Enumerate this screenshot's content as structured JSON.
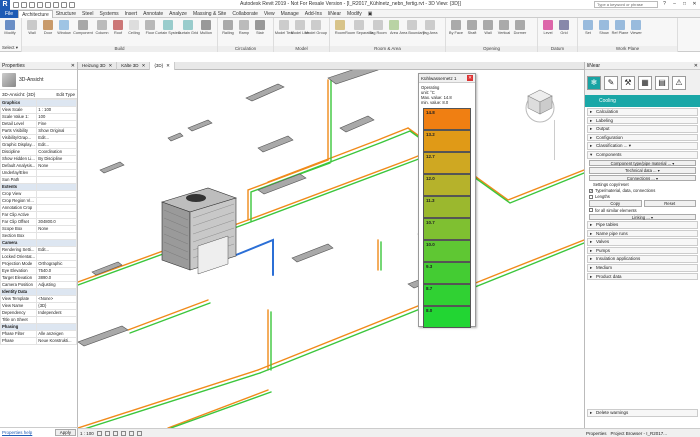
{
  "window": {
    "title": "Autodesk Revit 2019 - Not For Resale Version - [I_R2017_Kühlnetz_nebn_fertig.rvt - 3D View: {3D}]",
    "search_placeholder": "Type a keyword or phrase",
    "controls": [
      "?",
      "–",
      "□",
      "✕"
    ]
  },
  "ribbon": {
    "tabs": [
      "File",
      "Architecture",
      "Structure",
      "Steel",
      "Systems",
      "Insert",
      "Annotate",
      "Analyze",
      "Massing & Site",
      "Collaborate",
      "View",
      "Manage",
      "Add-Ins",
      "liNear",
      "Modify",
      "▣"
    ],
    "active_tab": "Architecture",
    "groups": [
      {
        "label": "Select",
        "tools": [
          "Modify"
        ]
      },
      {
        "label": "Build",
        "tools": [
          "Wall",
          "Door",
          "Window",
          "Component",
          "Column",
          "Roof",
          "Ceiling",
          "Floor",
          "Curtain System",
          "Curtain Grid",
          "Mullion"
        ]
      },
      {
        "label": "Circulation",
        "tools": [
          "Railing",
          "Ramp",
          "Stair"
        ]
      },
      {
        "label": "Model",
        "tools": [
          "Model Text",
          "Model Line",
          "Model Group"
        ]
      },
      {
        "label": "Room & Area",
        "tools": [
          "Room",
          "Room Separator",
          "Tag Room",
          "Area",
          "Area Boundary",
          "Tag Area"
        ]
      },
      {
        "label": "Opening",
        "tools": [
          "By Face",
          "Shaft",
          "Wall",
          "Vertical",
          "Dormer"
        ]
      },
      {
        "label": "Datum",
        "tools": [
          "Level",
          "Grid"
        ]
      },
      {
        "label": "Work Plane",
        "tools": [
          "Set",
          "Show",
          "Ref Plane",
          "Viewer"
        ]
      }
    ],
    "select_label": "Select ▾"
  },
  "properties": {
    "title": "Properties",
    "close": "✕",
    "type_name": "3D-Ansicht",
    "instance_dropdown": "3D-Ansicht: {3D}",
    "edit_type": "Edit Type",
    "rows": [
      {
        "k": "Graphics",
        "v": "",
        "section": true
      },
      {
        "k": "View Scale",
        "v": "1 : 100"
      },
      {
        "k": "Scale Value 1:",
        "v": "100"
      },
      {
        "k": "Detail Level",
        "v": "Fine"
      },
      {
        "k": "Parts Visibility",
        "v": "Show Original"
      },
      {
        "k": "Visibility/Grap...",
        "v": "Edit..."
      },
      {
        "k": "Graphic Display...",
        "v": "Edit..."
      },
      {
        "k": "Discipline",
        "v": "Coordination"
      },
      {
        "k": "Show Hidden Li...",
        "v": "By Discipline"
      },
      {
        "k": "Default Analysis...",
        "v": "None"
      },
      {
        "k": "Underlay/Elev",
        "v": ""
      },
      {
        "k": "Sun Path",
        "v": ""
      },
      {
        "k": "Extents",
        "v": "",
        "section": true
      },
      {
        "k": "Crop View",
        "v": ""
      },
      {
        "k": "Crop Region Vi...",
        "v": ""
      },
      {
        "k": "Annotation Crop",
        "v": ""
      },
      {
        "k": "Far Clip Active",
        "v": ""
      },
      {
        "k": "Far Clip Offset",
        "v": "304800.0"
      },
      {
        "k": "Scope Box",
        "v": "None"
      },
      {
        "k": "Section Box",
        "v": ""
      },
      {
        "k": "Camera",
        "v": "",
        "section": true
      },
      {
        "k": "Rendering Setti...",
        "v": "Edit..."
      },
      {
        "k": "Locked Orientat...",
        "v": ""
      },
      {
        "k": "Projection Mode",
        "v": "Orthographic"
      },
      {
        "k": "Eye Elevation",
        "v": "7540.0"
      },
      {
        "k": "Target Elevation",
        "v": "3890.0"
      },
      {
        "k": "Camera Position",
        "v": "Adjusting"
      },
      {
        "k": "Identity Data",
        "v": "",
        "section": true
      },
      {
        "k": "View Template",
        "v": "<None>"
      },
      {
        "k": "View Name",
        "v": "{3D}"
      },
      {
        "k": "Dependency",
        "v": "Independent"
      },
      {
        "k": "Title on Sheet",
        "v": ""
      },
      {
        "k": "Phasing",
        "v": "",
        "section": true
      },
      {
        "k": "Phase Filter",
        "v": "Alle anzeigen"
      },
      {
        "k": "Phase",
        "v": "Neue Konstrukti..."
      }
    ],
    "help": "Properties help",
    "apply": "Apply"
  },
  "view_tabs": [
    {
      "label": "Heizung 3D",
      "close": "✕"
    },
    {
      "label": "Kälte 3D",
      "close": "✕"
    },
    {
      "label": "{3D}",
      "close": "✕",
      "active": true
    }
  ],
  "legend": {
    "title": "Kühlwassernetz 1",
    "close": "✕",
    "info_lines": [
      "Operating",
      "unit: °C",
      "Max. value: 14.8",
      "min. value: 8.0"
    ],
    "bands": [
      {
        "label": "14.8",
        "color": "#f07f12"
      },
      {
        "label": "13.2",
        "color": "#e09a17"
      },
      {
        "label": "12.7",
        "color": "#cfa822"
      },
      {
        "label": "12.0",
        "color": "#b6b22b"
      },
      {
        "label": "11.3",
        "color": "#9bb82e"
      },
      {
        "label": "10.7",
        "color": "#7fc031"
      },
      {
        "label": "10.0",
        "color": "#5fc733"
      },
      {
        "label": "9.3",
        "color": "#44cc33"
      },
      {
        "label": "8.7",
        "color": "#30d133"
      },
      {
        "label": "8.0",
        "color": "#22d533"
      }
    ]
  },
  "viewbar": {
    "scale": "1 : 100"
  },
  "linear_panel": {
    "title": "liNear",
    "banner": "Cooling",
    "sections_top": [
      "Calculation",
      "Labeling",
      "Output",
      "Configuration",
      "Classification ... ▾"
    ],
    "components": {
      "label": "Components",
      "btn_component": "Component type/pipe material ... ▾",
      "btn_technical": "Technical data ... ▾",
      "btn_connections": "Connections ... ▾",
      "settings_label": "Settings copy/reset",
      "chk_type": "Type/material, data, connections",
      "chk_lengths": "Lengths",
      "btn_copy": "Copy",
      "btn_reset": "Reset",
      "chk_all": "for all similar elements",
      "btn_linking": "Linking ... ▾"
    },
    "sections_bottom": [
      "Pipe tables",
      "Name pipe runs",
      "Valves",
      "Pumps",
      "Insulation applications",
      "Medium",
      "Product data"
    ],
    "bottom_section": "Delete warnings"
  },
  "statusbar": {
    "tabs": [
      "Properties",
      "Project Browser - I_R2017..."
    ]
  },
  "colors": {
    "accent": "#1e5bb4",
    "teal": "#1aa7a7",
    "orange_pipe": "#f08a1a",
    "green_pipe": "#3cc63c"
  }
}
